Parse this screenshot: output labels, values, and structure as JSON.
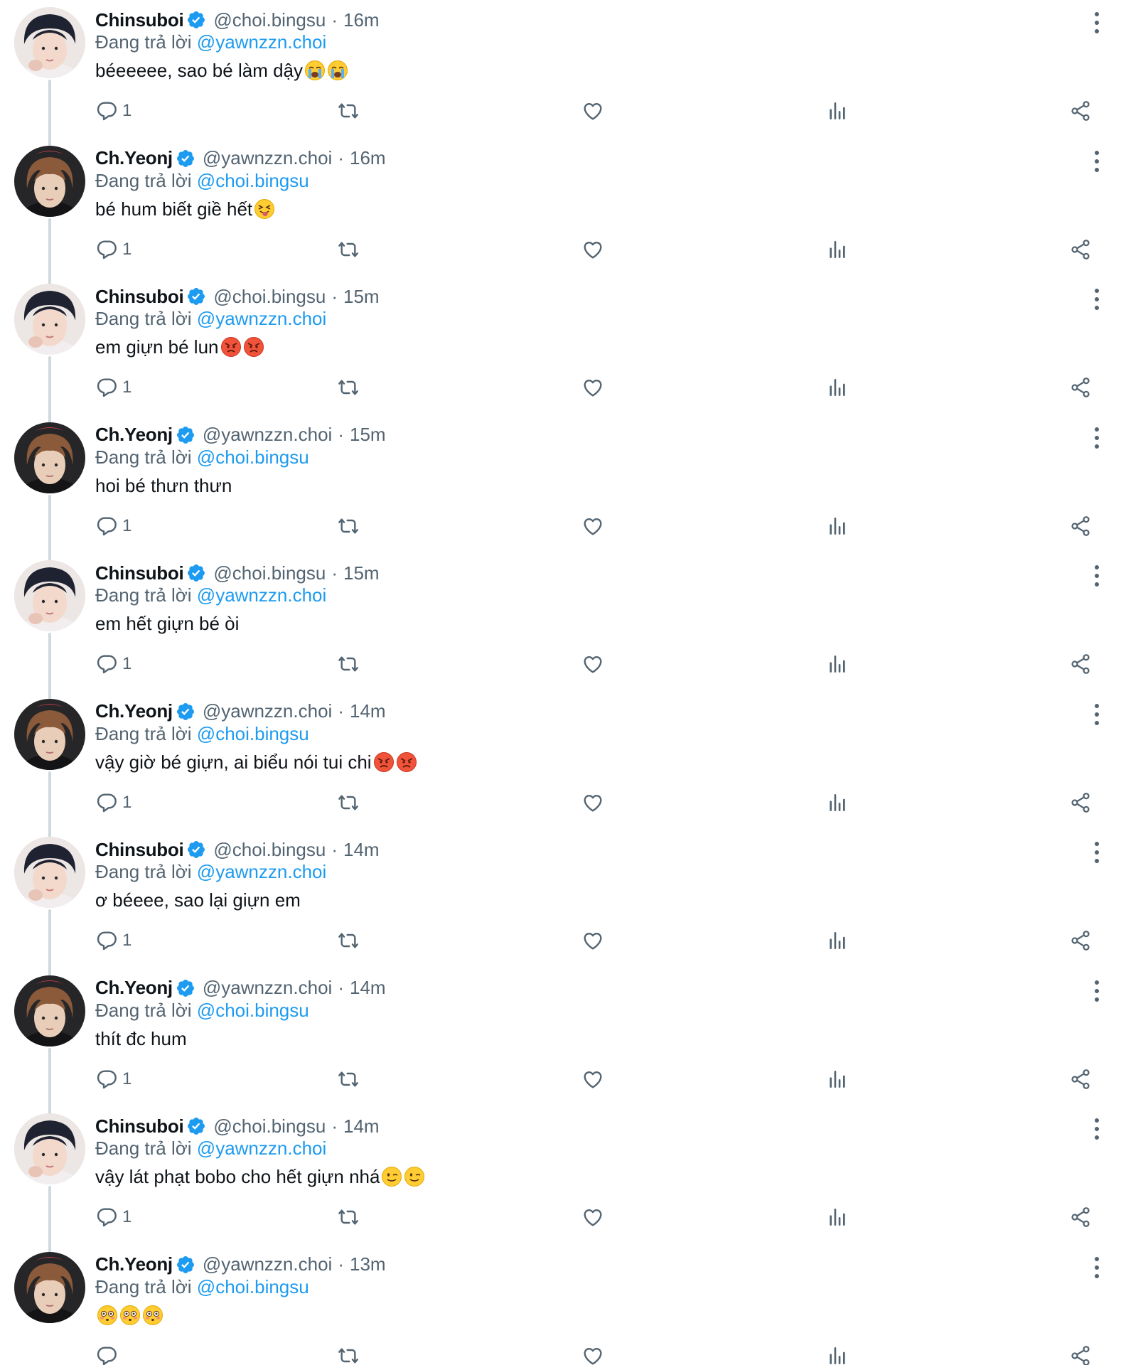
{
  "reply_prefix": "Đang trả lời",
  "colors": {
    "accent": "#1d9bf0",
    "secondary_text": "#536471",
    "primary_text": "#0f1419",
    "thread_line": "#cfd9de"
  },
  "icons": {
    "reply": "reply-icon",
    "retweet": "retweet-icon",
    "like": "heart-icon",
    "views": "analytics-icon",
    "share": "share-icon",
    "more": "more-vertical-icon",
    "verified": "verified-badge-icon"
  },
  "tweets": [
    {
      "author": "Chinsuboi",
      "handle": "@choi.bingsu",
      "time": "16m",
      "reply_to": "@yawnzzn.choi",
      "text": "béeeeee, sao bé làm dậy",
      "emojis": [
        "crying",
        "crying"
      ],
      "reply_count": "1",
      "avatar": "chinsuboi"
    },
    {
      "author": "Ch.Yeonj",
      "handle": "@yawnzzn.choi",
      "time": "16m",
      "reply_to": "@choi.bingsu",
      "text": "bé hum biết giề hết",
      "emojis": [
        "tongue"
      ],
      "reply_count": "1",
      "avatar": "chyeonj"
    },
    {
      "author": "Chinsuboi",
      "handle": "@choi.bingsu",
      "time": "15m",
      "reply_to": "@yawnzzn.choi",
      "text": "em giựn bé lun",
      "emojis": [
        "angry",
        "angry"
      ],
      "reply_count": "1",
      "avatar": "chinsuboi"
    },
    {
      "author": "Ch.Yeonj",
      "handle": "@yawnzzn.choi",
      "time": "15m",
      "reply_to": "@choi.bingsu",
      "text": "hoi bé thưn thưn",
      "emojis": [],
      "reply_count": "1",
      "avatar": "chyeonj"
    },
    {
      "author": "Chinsuboi",
      "handle": "@choi.bingsu",
      "time": "15m",
      "reply_to": "@yawnzzn.choi",
      "text": "em hết giựn bé òi",
      "emojis": [],
      "reply_count": "1",
      "avatar": "chinsuboi"
    },
    {
      "author": "Ch.Yeonj",
      "handle": "@yawnzzn.choi",
      "time": "14m",
      "reply_to": "@choi.bingsu",
      "text": "vậy giờ bé giựn, ai biểu nói tui chi",
      "emojis": [
        "angry",
        "angry"
      ],
      "reply_count": "1",
      "avatar": "chyeonj"
    },
    {
      "author": "Chinsuboi",
      "handle": "@choi.bingsu",
      "time": "14m",
      "reply_to": "@yawnzzn.choi",
      "text": "ơ béeee, sao lại giựn em",
      "emojis": [],
      "reply_count": "1",
      "avatar": "chinsuboi"
    },
    {
      "author": "Ch.Yeonj",
      "handle": "@yawnzzn.choi",
      "time": "14m",
      "reply_to": "@choi.bingsu",
      "text": "thít đc hum",
      "emojis": [],
      "reply_count": "1",
      "avatar": "chyeonj"
    },
    {
      "author": "Chinsuboi",
      "handle": "@choi.bingsu",
      "time": "14m",
      "reply_to": "@yawnzzn.choi",
      "text": "vậy lát phạt bobo cho hết giựn nhá",
      "emojis": [
        "wink",
        "wink"
      ],
      "reply_count": "1",
      "avatar": "chinsuboi"
    },
    {
      "author": "Ch.Yeonj",
      "handle": "@yawnzzn.choi",
      "time": "13m",
      "reply_to": "@choi.bingsu",
      "text": "",
      "emojis": [
        "flushed",
        "flushed",
        "flushed"
      ],
      "reply_count": "",
      "avatar": "chyeonj"
    }
  ]
}
